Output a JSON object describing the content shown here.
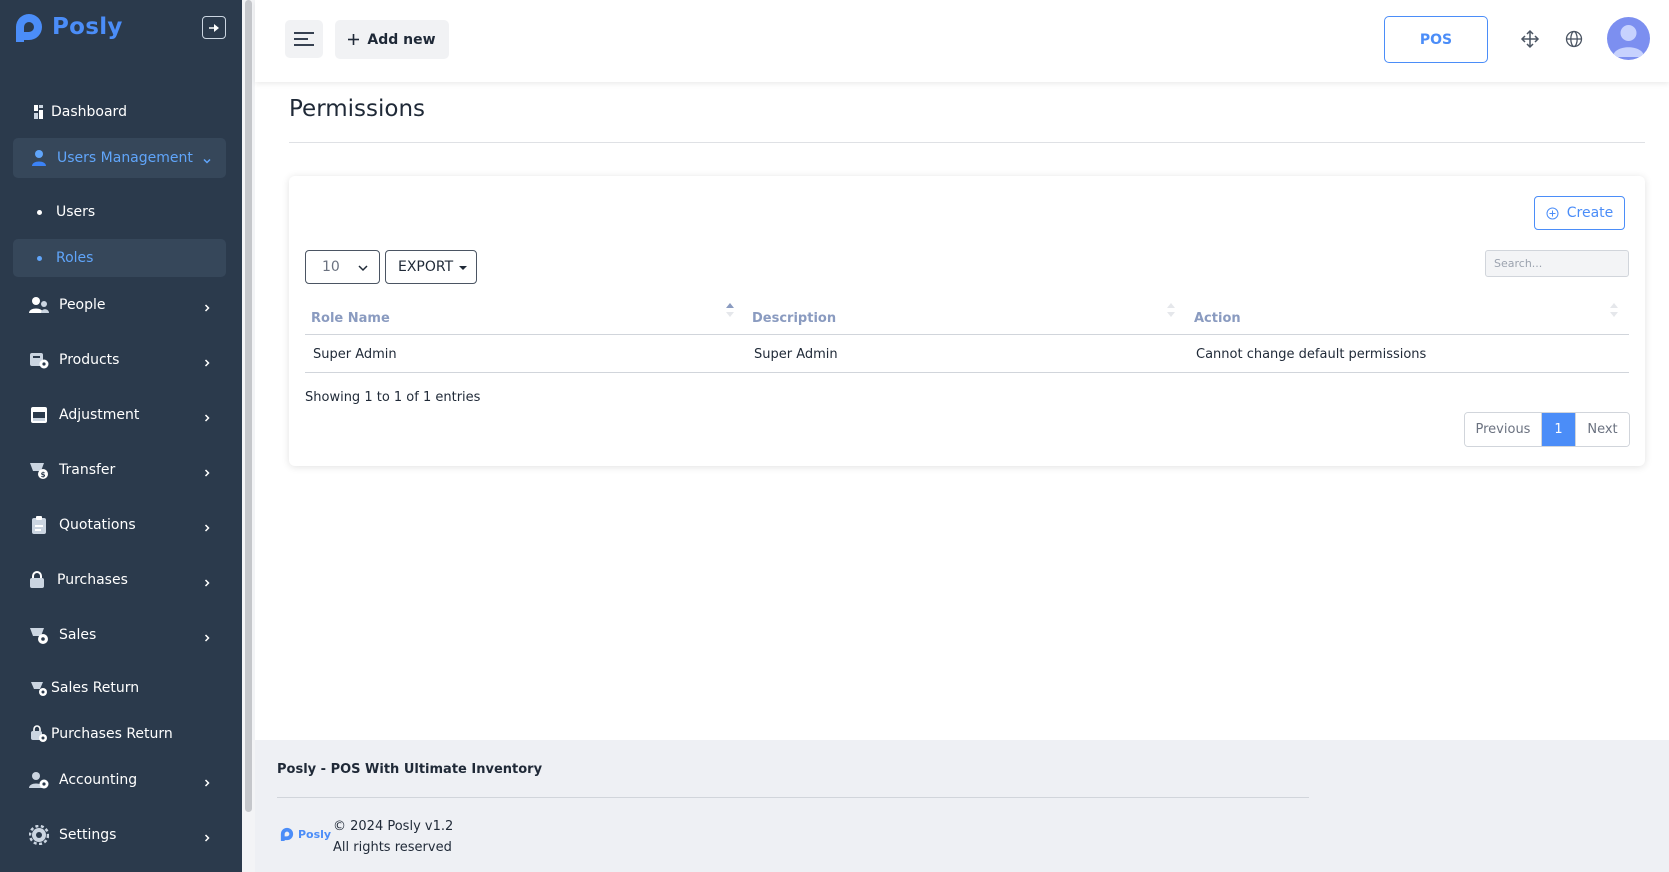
{
  "brand": {
    "name": "Posly",
    "accent": "#4b8df8",
    "sidebar_bg": "#2b3a4c"
  },
  "sidebar": {
    "items": [
      {
        "label": "Dashboard",
        "icon": "dashboard-icon"
      },
      {
        "label": "Users Management",
        "icon": "user-icon",
        "active": true,
        "expanded": true,
        "children": [
          {
            "label": "Users"
          },
          {
            "label": "Roles",
            "active": true
          }
        ]
      },
      {
        "label": "People",
        "icon": "people-icon"
      },
      {
        "label": "Products",
        "icon": "products-icon"
      },
      {
        "label": "Adjustment",
        "icon": "adjustment-icon"
      },
      {
        "label": "Transfer",
        "icon": "transfer-icon"
      },
      {
        "label": "Quotations",
        "icon": "quotations-icon"
      },
      {
        "label": "Purchases",
        "icon": "purchases-icon"
      },
      {
        "label": "Sales",
        "icon": "sales-icon"
      },
      {
        "label": "Sales Return",
        "icon": "sales-return-icon"
      },
      {
        "label": "Purchases Return",
        "icon": "purchases-return-icon"
      },
      {
        "label": "Accounting",
        "icon": "accounting-icon"
      },
      {
        "label": "Settings",
        "icon": "settings-icon"
      }
    ]
  },
  "header": {
    "add_new_label": "Add new",
    "pos_label": "POS"
  },
  "page": {
    "title": "Permissions",
    "create_label": "Create",
    "per_page": "10",
    "export_label": "EXPORT",
    "search_placeholder": "Search...",
    "table": {
      "columns": [
        "Role Name",
        "Description",
        "Action"
      ],
      "rows": [
        [
          "Super Admin",
          "Super Admin",
          "Cannot change default permissions"
        ]
      ]
    },
    "showing_text": "Showing 1 to 1 of 1 entries",
    "pagination": {
      "previous": "Previous",
      "current": "1",
      "next": "Next"
    }
  },
  "footer": {
    "title": "Posly - POS With Ultimate Inventory",
    "logo_text": "Posly",
    "copyright": "© 2024 Posly v1.2",
    "rights": "All rights reserved"
  }
}
